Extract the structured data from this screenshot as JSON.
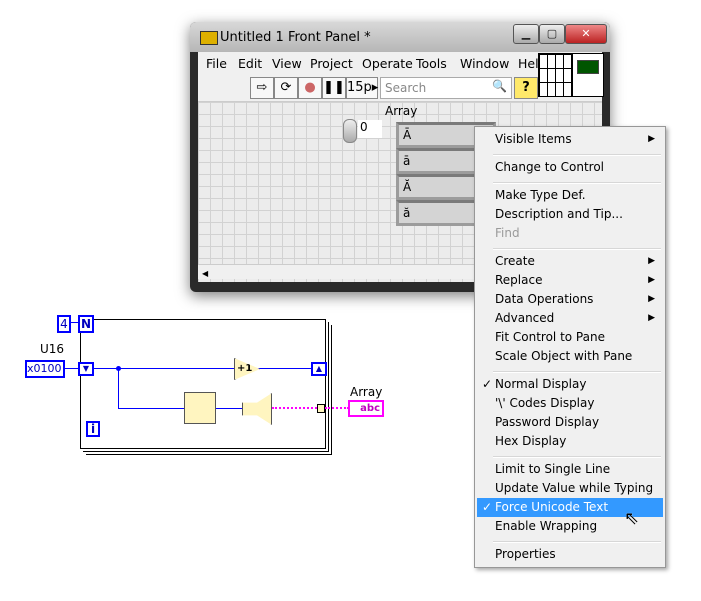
{
  "window": {
    "title": "Untitled 1 Front Panel *",
    "controls": [
      "minimize",
      "maximize",
      "close"
    ]
  },
  "menubar": [
    "File",
    "Edit",
    "View",
    "Project",
    "Operate",
    "Tools",
    "Window",
    "Hel"
  ],
  "toolbar": {
    "font": "15p",
    "search_placeholder": "Search",
    "help": "?"
  },
  "panel": {
    "array_label": "Array",
    "index": "0",
    "elements": [
      "Ā",
      "ā",
      "Ă",
      "ă"
    ]
  },
  "context_menu": [
    {
      "label": "Visible Items",
      "submenu": true
    },
    {
      "sep": true
    },
    {
      "label": "Change to Control"
    },
    {
      "sep": true
    },
    {
      "label": "Make Type Def."
    },
    {
      "label": "Description and Tip..."
    },
    {
      "label": "Find",
      "disabled": true
    },
    {
      "sep": true
    },
    {
      "label": "Create",
      "submenu": true
    },
    {
      "label": "Replace",
      "submenu": true
    },
    {
      "label": "Data Operations",
      "submenu": true
    },
    {
      "label": "Advanced",
      "submenu": true
    },
    {
      "label": "Fit Control to Pane"
    },
    {
      "label": "Scale Object with Pane"
    },
    {
      "sep": true
    },
    {
      "label": "Normal Display",
      "checked": true
    },
    {
      "label": "'\\' Codes Display"
    },
    {
      "label": "Password Display"
    },
    {
      "label": "Hex Display"
    },
    {
      "sep": true
    },
    {
      "label": "Limit to Single Line"
    },
    {
      "label": "Update Value while Typing"
    },
    {
      "label": "Force Unicode Text",
      "checked": true,
      "highlighted": true
    },
    {
      "label": "Enable Wrapping"
    },
    {
      "sep": true
    },
    {
      "label": "Properties"
    }
  ],
  "diagram": {
    "count": "4",
    "count_terminal": "N",
    "u16_label": "U16",
    "u16_value": "x0100",
    "iteration": "i",
    "increment": "+1",
    "array_label": "Array",
    "indicator": "abc"
  },
  "colors": {
    "highlight": "#3399ff",
    "wire_numeric": "#0000ff",
    "wire_string": "#ff00ff"
  }
}
